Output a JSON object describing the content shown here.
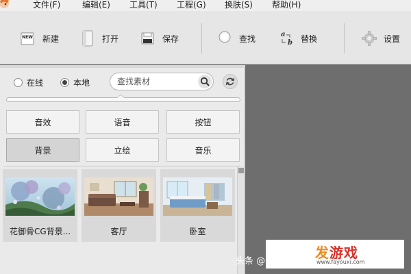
{
  "menu": {
    "items": [
      "文件(F)",
      "编辑(E)",
      "工具(T)",
      "工程(G)",
      "换肤(S)",
      "帮助(H)"
    ]
  },
  "toolbar": {
    "new_label": "新建",
    "open_label": "打开",
    "save_label": "保存",
    "find_label": "查找",
    "replace_label": "替换",
    "settings_label": "设置",
    "new_icon_text": "NEW",
    "replace_icon_a": "a",
    "replace_icon_b": "b"
  },
  "source": {
    "online_label": "在线",
    "local_label": "本地",
    "selected": "本地"
  },
  "search": {
    "placeholder": "查找素材"
  },
  "categories": [
    {
      "label": "音效",
      "active": false
    },
    {
      "label": "语音",
      "active": false
    },
    {
      "label": "按钮",
      "active": false
    },
    {
      "label": "背景",
      "active": true
    },
    {
      "label": "立绘",
      "active": false
    },
    {
      "label": "音乐",
      "active": false
    }
  ],
  "assets": [
    {
      "label": "花御骨CG背景..."
    },
    {
      "label": "客厅"
    },
    {
      "label": "卧室"
    }
  ],
  "watermark": {
    "source_text": "头条 @",
    "site_title": "发游戏",
    "site_title_first": "发",
    "site_title_rest": "游戏",
    "site_url": "www.fayouxi.com"
  },
  "colors": {
    "accent_orange": "#f08a1e",
    "accent_red": "#d8322a",
    "workspace_gray": "#6e6e6e"
  }
}
